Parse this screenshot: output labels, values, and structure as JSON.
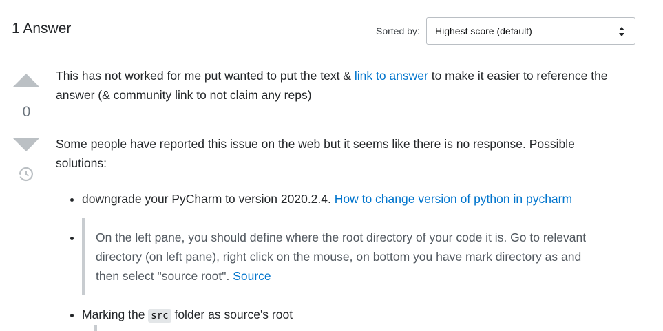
{
  "header": {
    "answer_count": "1 Answer",
    "sorted_label": "Sorted by:",
    "sort_value": "Highest score (default)"
  },
  "vote": {
    "score": "0"
  },
  "answer": {
    "intro_before_link": "This has not worked for me put wanted to put the text & ",
    "intro_link": "link to answer",
    "intro_after_link": " to make it easier to reference the answer (& community link to not claim any reps)",
    "body_text": "Some people have reported this issue on the web but it seems like there is no response. Possible solutions:",
    "bullet1_text": "downgrade your PyCharm to version 2020.2.4. ",
    "bullet1_link": "How to change version of python in pycharm",
    "quote_text": "On the left pane, you should define where the root directory of your code it is. Go to relevant directory (on left pane), right click on the mouse, on bottom you have mark directory as and then select \"source root\". ",
    "quote_link": "Source",
    "bullet3_before": "Marking the ",
    "bullet3_code": "src",
    "bullet3_after": " folder as source's root"
  },
  "colors": {
    "link": "#0074cc",
    "vote_arrow": "#bbc0c4",
    "quote_border": "#c8ccd0"
  },
  "icons": {
    "upvote": "upvote-arrow-icon",
    "downvote": "downvote-arrow-icon",
    "history": "history-icon",
    "select_arrows": "select-arrows-icon"
  }
}
